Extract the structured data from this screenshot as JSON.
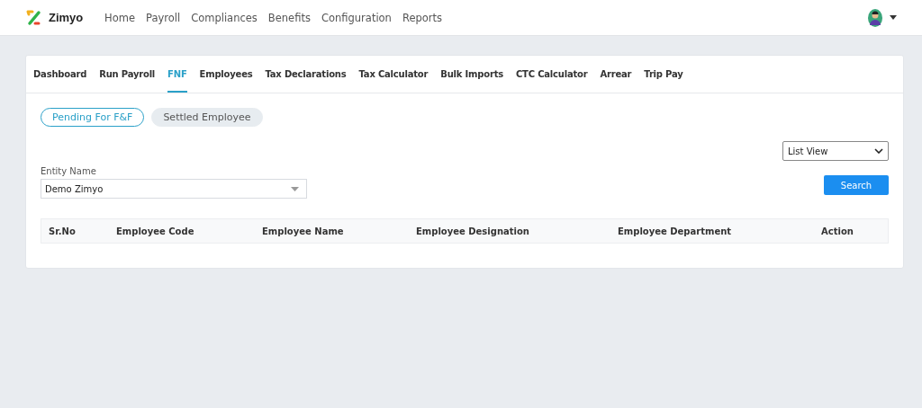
{
  "header": {
    "brand": "Zimyo",
    "nav": [
      "Home",
      "Payroll",
      "Compliances",
      "Benefits",
      "Configuration",
      "Reports"
    ]
  },
  "tabs": [
    {
      "label": "Dashboard",
      "selected": false
    },
    {
      "label": "Run Payroll",
      "selected": false
    },
    {
      "label": "FNF",
      "selected": true
    },
    {
      "label": "Employees",
      "selected": false
    },
    {
      "label": "Tax Declarations",
      "selected": false
    },
    {
      "label": "Tax Calculator",
      "selected": false
    },
    {
      "label": "Bulk Imports",
      "selected": false
    },
    {
      "label": "CTC Calculator",
      "selected": false
    },
    {
      "label": "Arrear",
      "selected": false
    },
    {
      "label": "Trip Pay",
      "selected": false
    }
  ],
  "pills": [
    {
      "label": "Pending For F&F",
      "selected": true
    },
    {
      "label": "Settled Employee",
      "selected": false
    }
  ],
  "view_select": {
    "value": "List View"
  },
  "entity": {
    "label": "Entity Name",
    "value": "Demo Zimyo"
  },
  "search_button": "Search",
  "table": {
    "columns": [
      "Sr.No",
      "Employee Code",
      "Employee Name",
      "Employee Designation",
      "Employee Department",
      "Action"
    ]
  }
}
